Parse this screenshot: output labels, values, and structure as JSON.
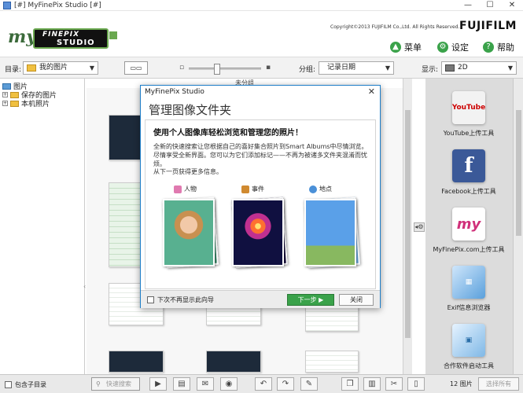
{
  "window": {
    "title": "[#] MyFinePix Studio [#]",
    "controls": [
      "—",
      "☐",
      "✕"
    ]
  },
  "header": {
    "logo_my": "my",
    "logo_line1": "FINEPIX",
    "logo_line2": "STUDIO",
    "copyright": "Copyright©2013 FUJIFILM Co.,Ltd. All Rights Reserved.",
    "brand": "FUJIFILM",
    "nav": [
      {
        "label": "菜单",
        "icon": "arrow-up-icon"
      },
      {
        "label": "设定",
        "icon": "gear-icon"
      },
      {
        "label": "帮助",
        "icon": "help-icon"
      }
    ]
  },
  "toolbar": {
    "dir_label": "目录:",
    "dir_value": "我的图片",
    "group_label": "分组:",
    "group_value": "记录日期",
    "display_label": "显示:",
    "display_value": "2D",
    "view_btn": "▭▭",
    "zoom_out": "▫",
    "zoom_in": "▪"
  },
  "tree": {
    "root": "图片",
    "children": [
      "保存的图片",
      "本机照片"
    ]
  },
  "main": {
    "header": "未分组"
  },
  "right_panel": {
    "items": [
      {
        "label": "YouTube上传工具",
        "tile_text": "YouTube",
        "color": "#e8e8e8"
      },
      {
        "label": "Facebook上传工具",
        "tile_text": "f",
        "color": "#3b5998"
      },
      {
        "label": "MyFinePix.com上传工具",
        "tile_text": "my",
        "color": "#ffffff"
      },
      {
        "label": "Exif信息浏览器",
        "tile_text": "",
        "color": "#e0f0ff"
      },
      {
        "label": "合作软件启动工具",
        "tile_text": "",
        "color": "#e0f0ff"
      }
    ]
  },
  "dialog": {
    "title": "MyFinePix Studio",
    "close": "✕",
    "heading": "管理图像文件夹",
    "subheading": "使用个人图像库轻松浏览和管理您的照片！",
    "description": "全新的快速搜索让您根据自己的喜好集合照片到Smart Albums中尽情浏览。尽情享受全新界面。您可以为它们添加标记——不再为被诸多文件夹混淆而忧烦。",
    "more": "从下一页获得更多信息。",
    "categories": [
      {
        "label": "人物",
        "color": "#e07ab0"
      },
      {
        "label": "事件",
        "color": "#d08a30"
      },
      {
        "label": "地点",
        "color": "#4a90d8"
      }
    ],
    "checkbox_label": "下次不再显示此向导",
    "next_button": "下一步 ▶",
    "close_button": "关闭"
  },
  "bottom": {
    "include_subdir": "包含子目录",
    "quick_search": "快速搜索",
    "count": "12 图片",
    "select_all": "选择所有"
  },
  "colors": {
    "accent_green": "#3aa24a",
    "brand_red": "#e60012",
    "dialog_border": "#1e7ec8"
  }
}
